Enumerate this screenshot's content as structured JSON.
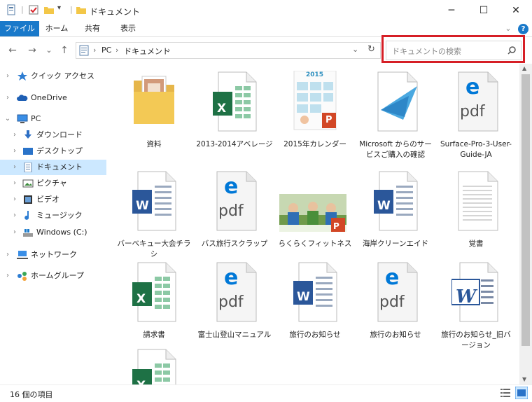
{
  "window": {
    "title": "ドキュメント",
    "minimize_glyph": "─",
    "maximize_glyph": "☐",
    "close_glyph": "✕"
  },
  "ribbon": {
    "tabs": [
      "ファイル",
      "ホーム",
      "共有",
      "表示"
    ],
    "expand_glyph": "⌄",
    "help_glyph": "?"
  },
  "nav": {
    "back": "←",
    "forward": "→",
    "recent": "⌄",
    "up": "↑"
  },
  "address": {
    "crumbs": [
      "PC",
      "ドキュメント"
    ],
    "sep": "›",
    "dropdown_glyph": "⌄",
    "refresh_glyph": "↻"
  },
  "search": {
    "placeholder": "ドキュメントの検索"
  },
  "sidebar": {
    "items": [
      {
        "label": "クイック アクセス",
        "icon": "star-icon"
      },
      {
        "label": "OneDrive",
        "icon": "cloud-icon"
      },
      {
        "label": "PC",
        "icon": "pc-icon"
      },
      {
        "label": "ダウンロード",
        "icon": "download-icon"
      },
      {
        "label": "デスクトップ",
        "icon": "desktop-icon"
      },
      {
        "label": "ドキュメント",
        "icon": "document-icon"
      },
      {
        "label": "ピクチャ",
        "icon": "picture-icon"
      },
      {
        "label": "ビデオ",
        "icon": "video-icon"
      },
      {
        "label": "ミュージック",
        "icon": "music-icon"
      },
      {
        "label": "Windows (C:)",
        "icon": "drive-icon"
      },
      {
        "label": "ネットワーク",
        "icon": "network-icon"
      },
      {
        "label": "ホームグループ",
        "icon": "homegroup-icon"
      }
    ]
  },
  "files": [
    {
      "name": "資料",
      "type": "folder"
    },
    {
      "name": "2013-2014アベレージ",
      "type": "excel"
    },
    {
      "name": "2015年カレンダー",
      "type": "ppt-calendar"
    },
    {
      "name": "Microsoft からのサービスご購入の確認",
      "type": "plane"
    },
    {
      "name": "Surface-Pro-3-User-Guide-JA",
      "type": "pdf"
    },
    {
      "name": "バーベキュー大会チラシ",
      "type": "word"
    },
    {
      "name": "バス旅行スクラップ",
      "type": "pdf"
    },
    {
      "name": "らくらくフィットネス",
      "type": "ppt-photo"
    },
    {
      "name": "海岸クリーンエイド",
      "type": "word"
    },
    {
      "name": "覚書",
      "type": "text"
    },
    {
      "name": "請求書",
      "type": "excel"
    },
    {
      "name": "富士山登山マニュアル",
      "type": "pdf"
    },
    {
      "name": "旅行のお知らせ",
      "type": "word"
    },
    {
      "name": "旅行のお知らせ",
      "type": "pdf"
    },
    {
      "name": "旅行のお知らせ_旧バージョン",
      "type": "word-old"
    },
    {
      "name": "",
      "type": "excel"
    }
  ],
  "badges": {
    "excel": "X",
    "word": "W",
    "pdf_e": "e",
    "pdf_text": "pdf",
    "ppt": "P",
    "calendar": "2015"
  },
  "status": {
    "count": "16 個の項目"
  },
  "colors": {
    "accent": "#1979ca",
    "highlight": "#d61f26",
    "selection": "#cce8ff",
    "excel": "#1e7145",
    "word": "#2b579a",
    "ppt": "#d24726",
    "pdf": "#0078d7"
  }
}
